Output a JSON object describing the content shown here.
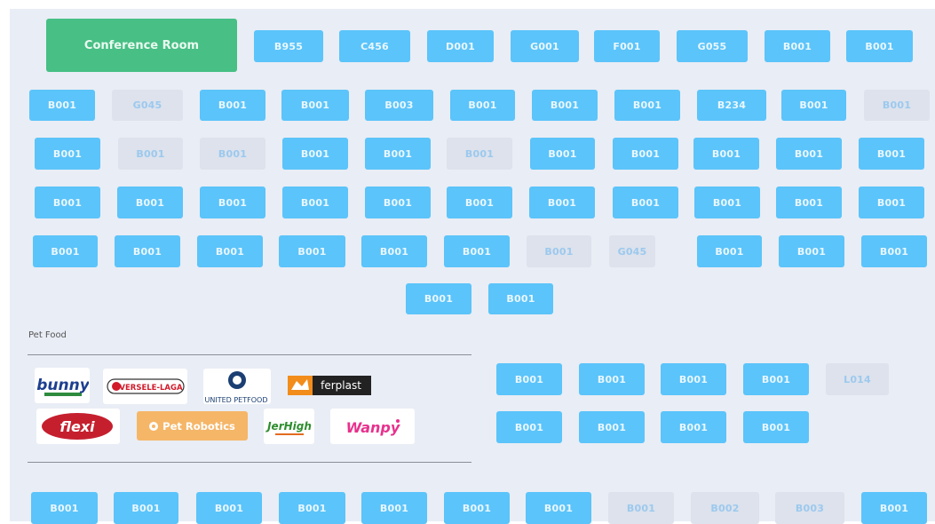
{
  "floor_plan": {
    "conference_room": "Conference Room",
    "section_title": "Pet Food",
    "status_colors": {
      "available": "#5bc4fa",
      "occupied": "#dde2ec",
      "conference": "#47bf85"
    },
    "booths": [
      {
        "label": "B955",
        "status": "available"
      },
      {
        "label": "C456",
        "status": "available"
      },
      {
        "label": "D001",
        "status": "available"
      },
      {
        "label": "G001",
        "status": "available"
      },
      {
        "label": "F001",
        "status": "available"
      },
      {
        "label": "G055",
        "status": "available"
      },
      {
        "label": "B001",
        "status": "available"
      },
      {
        "label": "B001",
        "status": "available"
      },
      {
        "label": "B001",
        "status": "available"
      },
      {
        "label": "G045",
        "status": "occupied"
      },
      {
        "label": "B001",
        "status": "available"
      },
      {
        "label": "B001",
        "status": "available"
      },
      {
        "label": "B003",
        "status": "available"
      },
      {
        "label": "B001",
        "status": "available"
      },
      {
        "label": "B001",
        "status": "available"
      },
      {
        "label": "B001",
        "status": "available"
      },
      {
        "label": "B234",
        "status": "available"
      },
      {
        "label": "B001",
        "status": "available"
      },
      {
        "label": "B001",
        "status": "occupied"
      },
      {
        "label": "B001",
        "status": "available"
      },
      {
        "label": "B001",
        "status": "occupied"
      },
      {
        "label": "B001",
        "status": "occupied"
      },
      {
        "label": "B001",
        "status": "available"
      },
      {
        "label": "B001",
        "status": "available"
      },
      {
        "label": "B001",
        "status": "occupied"
      },
      {
        "label": "B001",
        "status": "available"
      },
      {
        "label": "B001",
        "status": "available"
      },
      {
        "label": "B001",
        "status": "available"
      },
      {
        "label": "B001",
        "status": "available"
      },
      {
        "label": "B001",
        "status": "available"
      },
      {
        "label": "B001",
        "status": "available"
      },
      {
        "label": "B001",
        "status": "available"
      },
      {
        "label": "B001",
        "status": "available"
      },
      {
        "label": "B001",
        "status": "available"
      },
      {
        "label": "B001",
        "status": "available"
      },
      {
        "label": "B001",
        "status": "available"
      },
      {
        "label": "B001",
        "status": "available"
      },
      {
        "label": "B001",
        "status": "available"
      },
      {
        "label": "B001",
        "status": "available"
      },
      {
        "label": "B001",
        "status": "available"
      },
      {
        "label": "B001",
        "status": "available"
      },
      {
        "label": "B001",
        "status": "available"
      },
      {
        "label": "B001",
        "status": "available"
      },
      {
        "label": "B001",
        "status": "available"
      },
      {
        "label": "B001",
        "status": "available"
      },
      {
        "label": "B001",
        "status": "available"
      },
      {
        "label": "B001",
        "status": "available"
      },
      {
        "label": "B001",
        "status": "occupied"
      },
      {
        "label": "G045",
        "status": "occupied"
      },
      {
        "label": "B001",
        "status": "available"
      },
      {
        "label": "B001",
        "status": "available"
      },
      {
        "label": "B001",
        "status": "available"
      },
      {
        "label": "B001",
        "status": "available"
      },
      {
        "label": "B001",
        "status": "available"
      },
      {
        "label": "B001",
        "status": "available"
      },
      {
        "label": "B001",
        "status": "available"
      },
      {
        "label": "B001",
        "status": "available"
      },
      {
        "label": "B001",
        "status": "available"
      },
      {
        "label": "L014",
        "status": "occupied"
      },
      {
        "label": "B001",
        "status": "available"
      },
      {
        "label": "B001",
        "status": "available"
      },
      {
        "label": "B001",
        "status": "available"
      },
      {
        "label": "B001",
        "status": "available"
      },
      {
        "label": "B001",
        "status": "available"
      },
      {
        "label": "B001",
        "status": "available"
      },
      {
        "label": "B001",
        "status": "available"
      },
      {
        "label": "B001",
        "status": "available"
      },
      {
        "label": "B001",
        "status": "available"
      },
      {
        "label": "B001",
        "status": "available"
      },
      {
        "label": "B001",
        "status": "available"
      },
      {
        "label": "B001",
        "status": "occupied"
      },
      {
        "label": "B002",
        "status": "occupied"
      },
      {
        "label": "B003",
        "status": "occupied"
      },
      {
        "label": "B001",
        "status": "available"
      }
    ],
    "brands": [
      {
        "name": "bunny",
        "wordmark": "bunny"
      },
      {
        "name": "versele-laga",
        "wordmark": "VERSELE-LAGA"
      },
      {
        "name": "united-petfood",
        "wordmark": "UNITED PETFOOD"
      },
      {
        "name": "ferplast",
        "wordmark": "ferplast"
      },
      {
        "name": "flexi",
        "wordmark": "flexi"
      },
      {
        "name": "pet-robotics",
        "wordmark": "Pet Robotics",
        "logo_color": "#f5b668"
      },
      {
        "name": "jerhigh",
        "wordmark": "JerHigh"
      },
      {
        "name": "wanpy",
        "wordmark": "Wanpy"
      }
    ]
  }
}
